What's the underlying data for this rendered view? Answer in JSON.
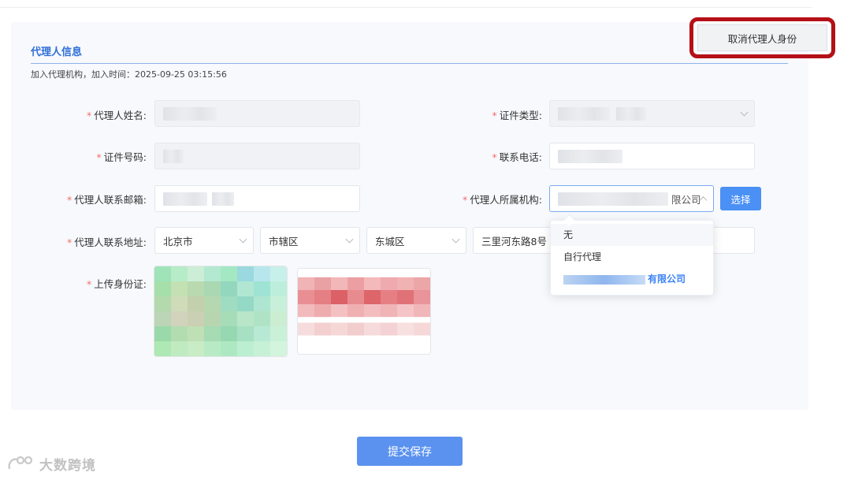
{
  "header": {
    "cancel_button_label": "取消代理人身份"
  },
  "section": {
    "title": "代理人信息",
    "subtitle": "加入代理机构，加入时间：2025-09-25 03:15:56"
  },
  "form": {
    "name_label": "代理人姓名:",
    "id_type_label": "证件类型:",
    "id_number_label": "证件号码:",
    "phone_label": "联系电话:",
    "email_label": "代理人联系邮箱:",
    "agency_label": "代理人所属机构:",
    "agency_value_suffix": "限公司",
    "select_button_label": "选择",
    "address_label": "代理人联系地址:",
    "province": "北京市",
    "city": "市辖区",
    "district": "东城区",
    "street": "三里河东路8号",
    "upload_label": "上传身份证:"
  },
  "dropdown": {
    "options": [
      "无",
      "自行代理"
    ],
    "selected_suffix": "有限公司"
  },
  "footer": {
    "submit_label": "提交保存"
  },
  "watermark": {
    "text": "大数跨境"
  },
  "colors": {
    "accent": "#4a90f5",
    "required": "#f56c6c",
    "highlight": "#b50f17"
  }
}
